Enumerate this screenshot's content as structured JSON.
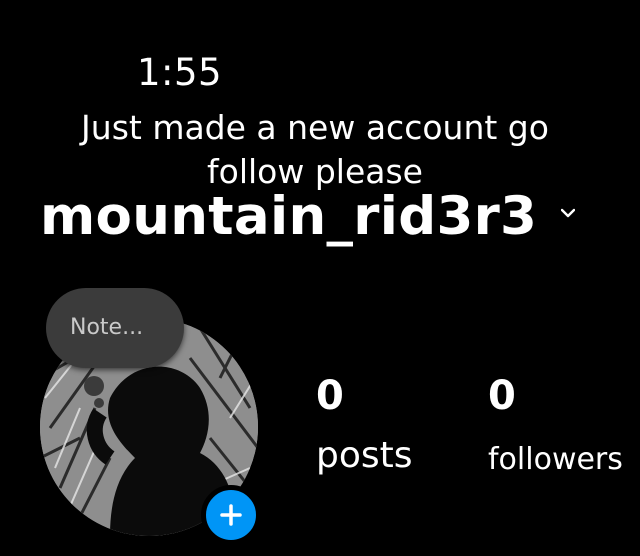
{
  "status_bar": {
    "time": "1:55"
  },
  "caption": {
    "text": "Just made a new account go follow please"
  },
  "profile": {
    "username": "mountain_rid3r3",
    "note_placeholder": "Note...",
    "stats": {
      "posts_value": "0",
      "posts_label": "posts",
      "followers_value": "0",
      "followers_label": "followers"
    }
  },
  "icons": {
    "username_dropdown": "chevron-down-icon",
    "add_story": "plus-icon"
  },
  "colors": {
    "background": "#000000",
    "text": "#ffffff",
    "note_bubble": "#3b3b3b",
    "add_button": "#0095f6"
  }
}
